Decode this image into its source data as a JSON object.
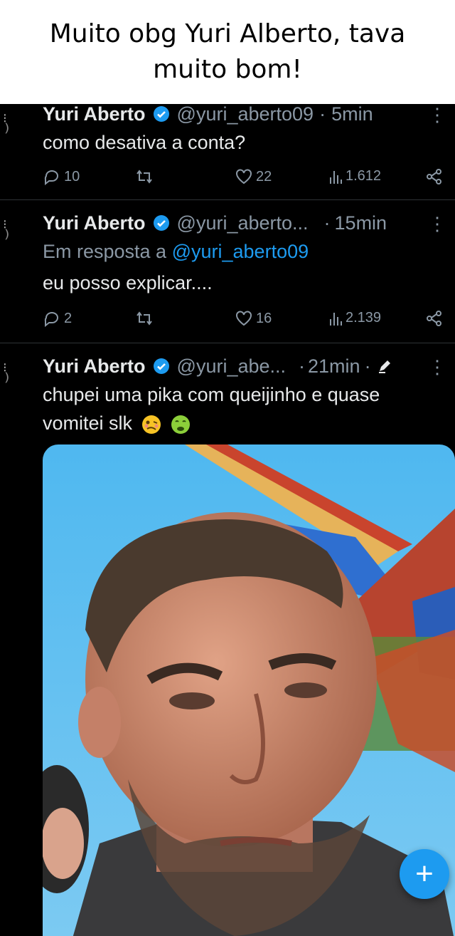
{
  "caption": "Muito obg Yuri Alberto, tava muito bom!",
  "tweets": [
    {
      "name": "Yuri Aberto",
      "handle": "@yuri_aberto09",
      "sep": "·",
      "time": "5min",
      "text": "como desativa a conta?",
      "replies": "10",
      "likes": "22",
      "views": "1.612"
    },
    {
      "name": "Yuri Aberto",
      "handle": "@yuri_aberto...",
      "sep": "·",
      "time": "15min",
      "reply_prefix": "Em resposta a",
      "reply_to": "@yuri_aberto09",
      "text": "eu posso explicar....",
      "replies": "2",
      "likes": "16",
      "views": "2.139"
    },
    {
      "name": "Yuri Aberto",
      "handle": "@yuri_abe...",
      "sep": "·",
      "time": "21min",
      "sep2": "·",
      "text_line1": "chupei uma pika com queijinho e quase",
      "text_line2": "vomitei slk"
    }
  ],
  "fab_label": "+",
  "colors": {
    "accent": "#1d9bf0",
    "muted": "#8b98a5",
    "background": "#000000"
  },
  "icons": [
    "reply-icon",
    "retweet-icon",
    "like-icon",
    "views-icon",
    "share-icon",
    "verified-icon",
    "more-icon",
    "edit-icon"
  ]
}
